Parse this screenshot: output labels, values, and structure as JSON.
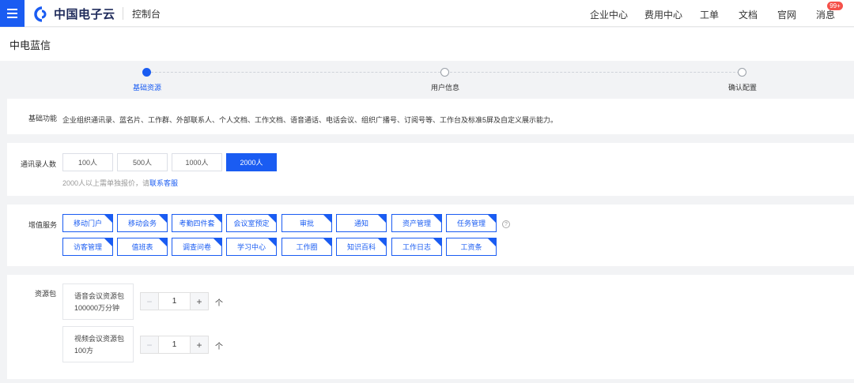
{
  "header": {
    "logo_text": "中国电子云",
    "console": "控制台",
    "nav": [
      "企业中心",
      "费用中心",
      "工单",
      "文档",
      "官网",
      "消息"
    ],
    "badge": "99+"
  },
  "page": {
    "title": "中电蓝信"
  },
  "steps": [
    {
      "label": "基础资源",
      "active": true
    },
    {
      "label": "用户信息",
      "active": false
    },
    {
      "label": "确认配置",
      "active": false
    }
  ],
  "basic": {
    "label": "基础功能",
    "text": "企业组织通讯录、蓝名片、工作群、外部联系人、个人文档、工作文档、语音通话、电话会议、组织广播号、订阅号等、工作台及标准5屏及自定义展示能力。"
  },
  "contacts": {
    "label": "通讯录人数",
    "options": [
      "100人",
      "500人",
      "1000人",
      "2000人"
    ],
    "selected": "2000人",
    "hint": "2000人以上需单独报价，请",
    "hint_link": "联系客服"
  },
  "services": {
    "label": "增值服务",
    "row1": [
      "移动门户",
      "移动会务",
      "考勤四件套",
      "会议室预定",
      "审批",
      "通知",
      "资产管理",
      "任务管理"
    ],
    "row2": [
      "访客管理",
      "值班表",
      "调查问卷",
      "学习中心",
      "工作圈",
      "知识百科",
      "工作日志",
      "工资条"
    ],
    "help_symbol": "?"
  },
  "resources": {
    "label": "资源包",
    "items": [
      {
        "line1": "语音会议资源包",
        "line2": "100000万分钟",
        "qty": "1",
        "unit": "个"
      },
      {
        "line1": "视频会议资源包",
        "line2": "100方",
        "qty": "1",
        "unit": "个"
      }
    ]
  },
  "colors": {
    "primary": "#1a5cf2",
    "badge": "#f5514a",
    "bg": "#f2f3f5"
  }
}
